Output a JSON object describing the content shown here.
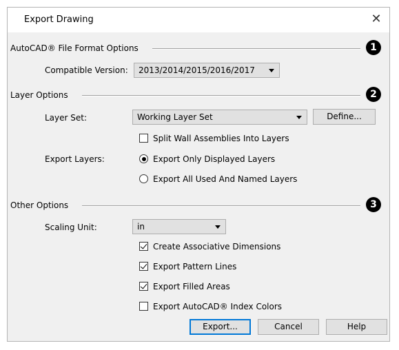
{
  "window": {
    "title": "Export Drawing",
    "close_glyph": "✕"
  },
  "sections": {
    "autocad": {
      "label": "AutoCAD® File Format Options",
      "number": "1"
    },
    "layer": {
      "label": "Layer Options",
      "number": "2"
    },
    "other": {
      "label": "Other Options",
      "number": "3"
    }
  },
  "compatible_version": {
    "label": "Compatible Version:",
    "value": "2013/2014/2015/2016/2017"
  },
  "layer_set": {
    "label": "Layer Set:",
    "value": "Working Layer Set",
    "define_label": "Define..."
  },
  "split_walls": {
    "label": "Split Wall Assemblies Into Layers",
    "checked": false
  },
  "export_layers": {
    "label": "Export Layers:",
    "options": [
      {
        "label": "Export Only Displayed Layers",
        "selected": true
      },
      {
        "label": "Export All Used And Named Layers",
        "selected": false
      }
    ]
  },
  "scaling_unit": {
    "label": "Scaling Unit:",
    "value": "in"
  },
  "other_checks": [
    {
      "label": "Create Associative Dimensions",
      "checked": true
    },
    {
      "label": "Export Pattern Lines",
      "checked": true
    },
    {
      "label": "Export Filled Areas",
      "checked": true
    },
    {
      "label": "Export AutoCAD® Index Colors",
      "checked": false
    }
  ],
  "buttons": {
    "export": "Export...",
    "cancel": "Cancel",
    "help": "Help"
  }
}
